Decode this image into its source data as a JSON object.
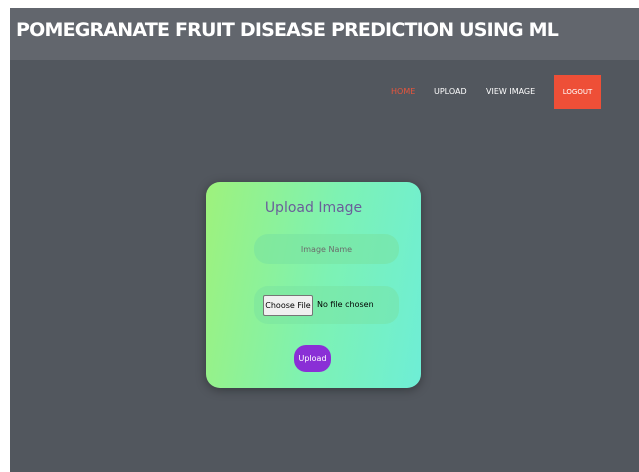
{
  "header": {
    "title": "POMEGRANATE FRUIT DISEASE PREDICTION USING ML"
  },
  "nav": {
    "items": [
      {
        "label": "HOME",
        "active": true
      },
      {
        "label": "UPLOAD",
        "active": false
      },
      {
        "label": "VIEW IMAGE",
        "active": false
      }
    ],
    "logout_label": "LOGOUT"
  },
  "form": {
    "title": "Upload Image",
    "image_name_placeholder": "Image Name",
    "choose_file_label": "Choose File",
    "file_status": "No file chosen",
    "submit_label": "Upload"
  },
  "colors": {
    "background": "#52575e",
    "title_bar": "#62666d",
    "active_nav": "#e8553c",
    "logout": "#ee4f37",
    "submit": "#8a2fd6"
  }
}
